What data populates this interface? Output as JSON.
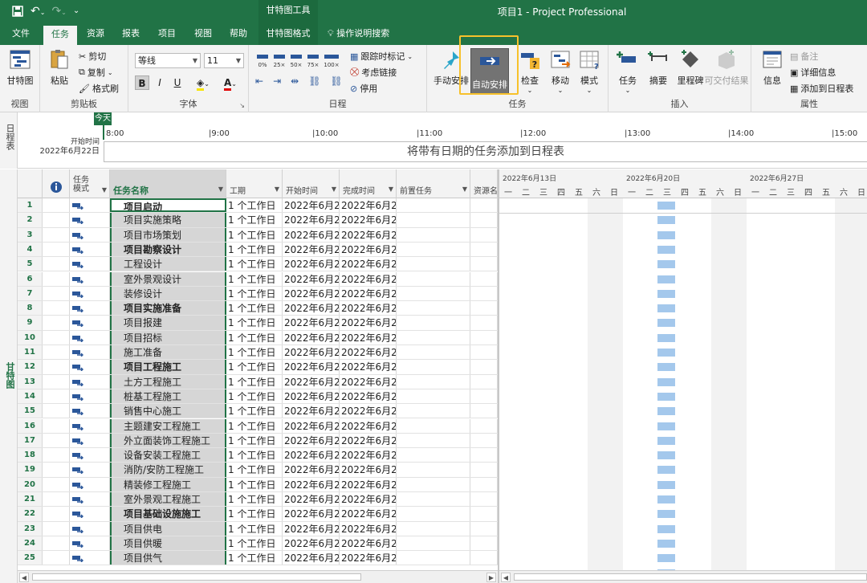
{
  "window": {
    "app_title": "项目1  -  Project Professional",
    "context_tool": "甘特图工具"
  },
  "tabs": [
    {
      "label": "文件"
    },
    {
      "label": "任务",
      "active": true
    },
    {
      "label": "资源"
    },
    {
      "label": "报表"
    },
    {
      "label": "项目"
    },
    {
      "label": "视图"
    },
    {
      "label": "帮助"
    },
    {
      "label": "甘特图格式"
    },
    {
      "label": "操作说明搜索"
    }
  ],
  "ribbon": {
    "view_group": {
      "label": "视图",
      "gantt_button": "甘特图"
    },
    "clipboard_group": {
      "label": "剪贴板",
      "paste": "粘贴",
      "cut": "剪切",
      "copy": "复制",
      "format_painter": "格式刷"
    },
    "font_group": {
      "label": "字体",
      "font_name": "等线",
      "font_size": "11",
      "bold": "B",
      "italic": "I",
      "underline": "U"
    },
    "schedule_group": {
      "label": "日程",
      "track_mark": "跟踪时标记",
      "respect_links": "考虑链接",
      "inactivate": "停用"
    },
    "tasks_group": {
      "label": "任务",
      "manual": "手动安排",
      "auto": "自动安排",
      "inspect": "检查",
      "move": "移动",
      "mode": "模式"
    },
    "insert_group": {
      "label": "插入",
      "task": "任务",
      "summary": "摘要",
      "milestone": "里程碑",
      "deliverable": "可交付结果"
    },
    "properties_group": {
      "label": "属性",
      "notes": "备注",
      "details": "详细信息",
      "add_timeline": "添加到日程表",
      "info": "信息"
    }
  },
  "timeline": {
    "side_label": "日程表",
    "today": "今天",
    "start_label": "开始时间",
    "start_date": "2022年6月22日",
    "ticks": [
      "8:00",
      "|9:00",
      "|10:00",
      "|11:00",
      "|12:00",
      "|13:00",
      "|14:00",
      "|15:00"
    ],
    "placeholder": "将带有日期的任务添加到日程表"
  },
  "gantt": {
    "side_label": "甘特图",
    "columns": {
      "info": "i",
      "mode_line1": "任务",
      "mode_line2": "模式",
      "name": "任务名称",
      "duration": "工期",
      "start": "开始时间",
      "finish": "完成时间",
      "predecessors": "前置任务",
      "resources": "资源名"
    },
    "tasks": [
      {
        "id": "1",
        "name": "项目启动",
        "bold": true,
        "duration": "1 个工作日",
        "start": "2022年6月2",
        "finish": "2022年6月2"
      },
      {
        "id": "2",
        "name": "项目实施策略",
        "bold": false,
        "duration": "1 个工作日",
        "start": "2022年6月2",
        "finish": "2022年6月2"
      },
      {
        "id": "3",
        "name": "项目市场策划",
        "bold": false,
        "duration": "1 个工作日",
        "start": "2022年6月2",
        "finish": "2022年6月2"
      },
      {
        "id": "4",
        "name": "项目勘察设计",
        "bold": true,
        "duration": "1 个工作日",
        "start": "2022年6月2",
        "finish": "2022年6月2"
      },
      {
        "id": "5",
        "name": "工程设计",
        "bold": false,
        "duration": "1 个工作日",
        "start": "2022年6月2",
        "finish": "2022年6月2"
      },
      {
        "id": "6",
        "name": "室外景观设计",
        "bold": false,
        "duration": "1 个工作日",
        "start": "2022年6月2",
        "finish": "2022年6月2"
      },
      {
        "id": "7",
        "name": "装修设计",
        "bold": false,
        "duration": "1 个工作日",
        "start": "2022年6月2",
        "finish": "2022年6月2"
      },
      {
        "id": "8",
        "name": "项目实施准备",
        "bold": true,
        "duration": "1 个工作日",
        "start": "2022年6月2",
        "finish": "2022年6月2"
      },
      {
        "id": "9",
        "name": "项目报建",
        "bold": false,
        "duration": "1 个工作日",
        "start": "2022年6月2",
        "finish": "2022年6月2"
      },
      {
        "id": "10",
        "name": "项目招标",
        "bold": false,
        "duration": "1 个工作日",
        "start": "2022年6月2",
        "finish": "2022年6月2"
      },
      {
        "id": "11",
        "name": "施工准备",
        "bold": false,
        "duration": "1 个工作日",
        "start": "2022年6月2",
        "finish": "2022年6月2"
      },
      {
        "id": "12",
        "name": "项目工程施工",
        "bold": true,
        "duration": "1 个工作日",
        "start": "2022年6月2",
        "finish": "2022年6月2"
      },
      {
        "id": "13",
        "name": "土方工程施工",
        "bold": false,
        "duration": "1 个工作日",
        "start": "2022年6月2",
        "finish": "2022年6月2"
      },
      {
        "id": "14",
        "name": "桩基工程施工",
        "bold": false,
        "duration": "1 个工作日",
        "start": "2022年6月2",
        "finish": "2022年6月2"
      },
      {
        "id": "15",
        "name": "销售中心施工",
        "bold": false,
        "duration": "1 个工作日",
        "start": "2022年6月2",
        "finish": "2022年6月2"
      },
      {
        "id": "16",
        "name": "主题建安工程施工",
        "bold": false,
        "duration": "1 个工作日",
        "start": "2022年6月2",
        "finish": "2022年6月2"
      },
      {
        "id": "17",
        "name": "外立面装饰工程施工",
        "bold": false,
        "duration": "1 个工作日",
        "start": "2022年6月2",
        "finish": "2022年6月2"
      },
      {
        "id": "18",
        "name": "设备安装工程施工",
        "bold": false,
        "duration": "1 个工作日",
        "start": "2022年6月2",
        "finish": "2022年6月2"
      },
      {
        "id": "19",
        "name": "消防/安防工程施工",
        "bold": false,
        "duration": "1 个工作日",
        "start": "2022年6月2",
        "finish": "2022年6月2"
      },
      {
        "id": "20",
        "name": "精装修工程施工",
        "bold": false,
        "duration": "1 个工作日",
        "start": "2022年6月2",
        "finish": "2022年6月2"
      },
      {
        "id": "21",
        "name": "室外景观工程施工",
        "bold": false,
        "duration": "1 个工作日",
        "start": "2022年6月2",
        "finish": "2022年6月2"
      },
      {
        "id": "22",
        "name": "项目基础设施施工",
        "bold": true,
        "duration": "1 个工作日",
        "start": "2022年6月2",
        "finish": "2022年6月2"
      },
      {
        "id": "23",
        "name": "项目供电",
        "bold": false,
        "duration": "1 个工作日",
        "start": "2022年6月2",
        "finish": "2022年6月2"
      },
      {
        "id": "24",
        "name": "项目供暖",
        "bold": false,
        "duration": "1 个工作日",
        "start": "2022年6月2",
        "finish": "2022年6月2"
      },
      {
        "id": "25",
        "name": "项目供气",
        "bold": false,
        "duration": "1 个工作日",
        "start": "2022年6月2",
        "finish": "2022年6月2"
      }
    ]
  },
  "chart": {
    "weeks": [
      "2022年6月13日",
      "2022年6月20日",
      "2022年6月27日"
    ],
    "days": [
      "一",
      "二",
      "三",
      "四",
      "五",
      "六",
      "日",
      "一",
      "二",
      "三",
      "四",
      "五",
      "六",
      "日",
      "一",
      "二",
      "三",
      "四",
      "五",
      "六",
      "日"
    ]
  },
  "colors": {
    "accent": "#217346",
    "bar_hatch": "#a4c8ec",
    "highlight": "#f7c12b",
    "auto_btn": "#737373"
  }
}
